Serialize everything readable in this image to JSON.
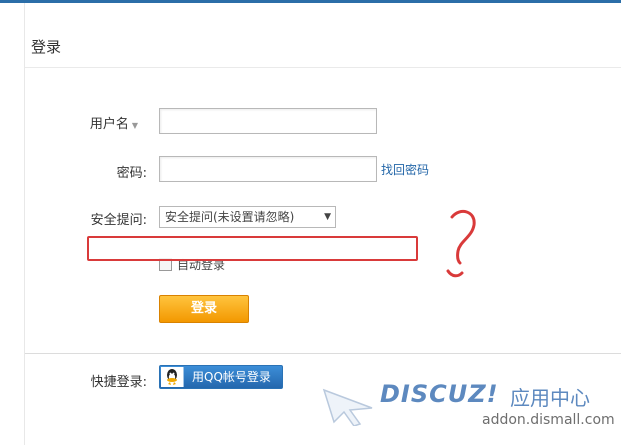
{
  "page": {
    "title": "登录"
  },
  "form": {
    "username_label": "用户名",
    "password_label": "密码:",
    "forgot_password_link": "找回密码",
    "security_question_label": "安全提问:",
    "security_question_value": "安全提问(未设置请忽略)",
    "auto_login_label": "自动登录",
    "submit_label": "登录"
  },
  "quick_login": {
    "label": "快捷登录:",
    "qq_button_label": "用QQ帐号登录"
  },
  "annotation": {
    "question_mark": "?"
  },
  "watermark": {
    "brand": "DISCUZ!",
    "subtitle": "应用中心",
    "url": "addon.dismall.com"
  },
  "colors": {
    "accent_blue": "#2b6ea8",
    "link_blue": "#2366a8",
    "button_orange": "#f39800",
    "annotation_red": "#d93a3a"
  }
}
